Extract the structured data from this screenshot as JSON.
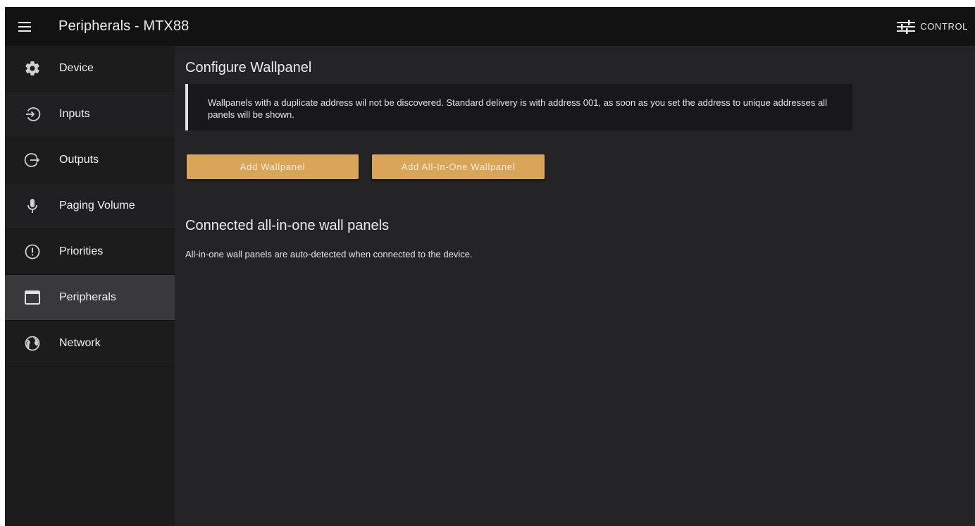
{
  "app": {
    "title": "Peripherals - MTX88",
    "menu_icon": "hamburger-menu-icon",
    "control": {
      "label": "CONTROL",
      "icon": "sliders-icon"
    }
  },
  "sidebar": {
    "items": [
      {
        "label": "Device",
        "icon": "gear-icon"
      },
      {
        "label": "Inputs",
        "icon": "input-arrow-icon"
      },
      {
        "label": "Outputs",
        "icon": "output-arrow-icon"
      },
      {
        "label": "Paging Volume",
        "icon": "microphone-icon"
      },
      {
        "label": "Priorities",
        "icon": "exclamation-circle-icon"
      },
      {
        "label": "Peripherals",
        "icon": "window-icon",
        "active": true
      },
      {
        "label": "Network",
        "icon": "globe-icon"
      }
    ]
  },
  "main": {
    "configure_title": "Configure Wallpanel",
    "info_text": "Wallpanels with a duplicate address wil not be discovered. Standard delivery is with address 001, as soon as you set the address to unique addresses all panels will be shown.",
    "buttons": {
      "add_wallpanel": "Add Wallpanel",
      "add_aio_wallpanel": "Add All-In-One Wallpanel"
    },
    "connected_title": "Connected all-in-one wall panels",
    "connected_subtitle": "All-in-one wall panels are auto-detected when connected to the device."
  },
  "colors": {
    "appbar": "#121212",
    "sidebar": "#1c1c1d",
    "sidebar_active": "#39393b",
    "content_bg": "#242426",
    "accent_button": "#d9a659"
  }
}
